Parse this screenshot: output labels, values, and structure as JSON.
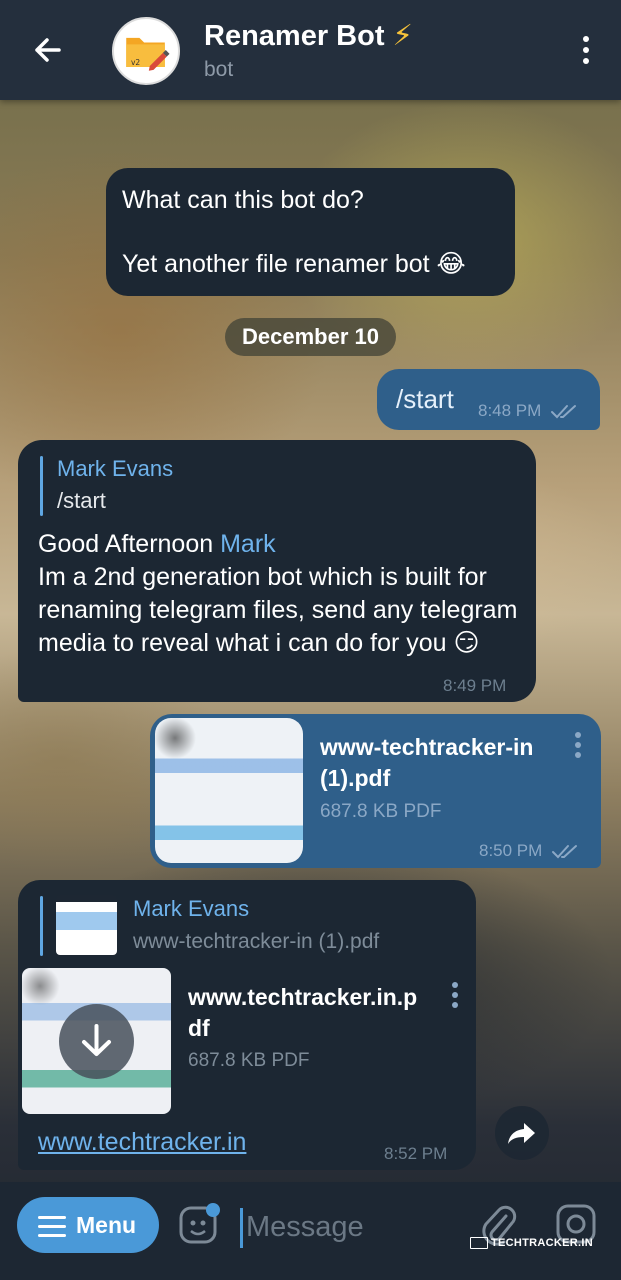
{
  "header": {
    "title": "Renamer Bot",
    "bolt": "⚡",
    "subtitle": "bot",
    "avatar_badge": "v2"
  },
  "bot_info": {
    "line1": "What can this bot do?",
    "line2": "Yet another file renamer bot 😂"
  },
  "date_separator": "December 10",
  "messages": {
    "start": {
      "text": "/start",
      "time": "8:48 PM"
    },
    "reply": {
      "quote_name": "Mark Evans",
      "quote_text": "/start",
      "greeting": "Good Afternoon ",
      "greeting_name": "Mark",
      "body": "Im a 2nd generation bot which is built for renaming telegram files, send any telegram media to reveal what i can do for you 😏",
      "time": "8:49 PM"
    },
    "file_out": {
      "name_line1": "www-techtracker-in",
      "name_line2": "(1).pdf",
      "size": "687.8 KB PDF",
      "time": "8:50 PM"
    },
    "file_in": {
      "quote_name": "Mark Evans",
      "quote_text": "www-techtracker-in (1).pdf",
      "name_line1": "www.techtracker.in.p",
      "name_line2": "df",
      "size": "687.8 KB PDF",
      "link": "www.techtracker.in",
      "time": "8:52 PM"
    }
  },
  "composer": {
    "menu_label": "Menu",
    "placeholder": "Message"
  },
  "watermark": "TECHTRACKER.IN",
  "colors": {
    "header_bg": "#242f3d",
    "bubble_in": "#1c2733",
    "bubble_out": "#2f5f8a",
    "accent": "#4a99d8",
    "link": "#6fb3ec"
  }
}
